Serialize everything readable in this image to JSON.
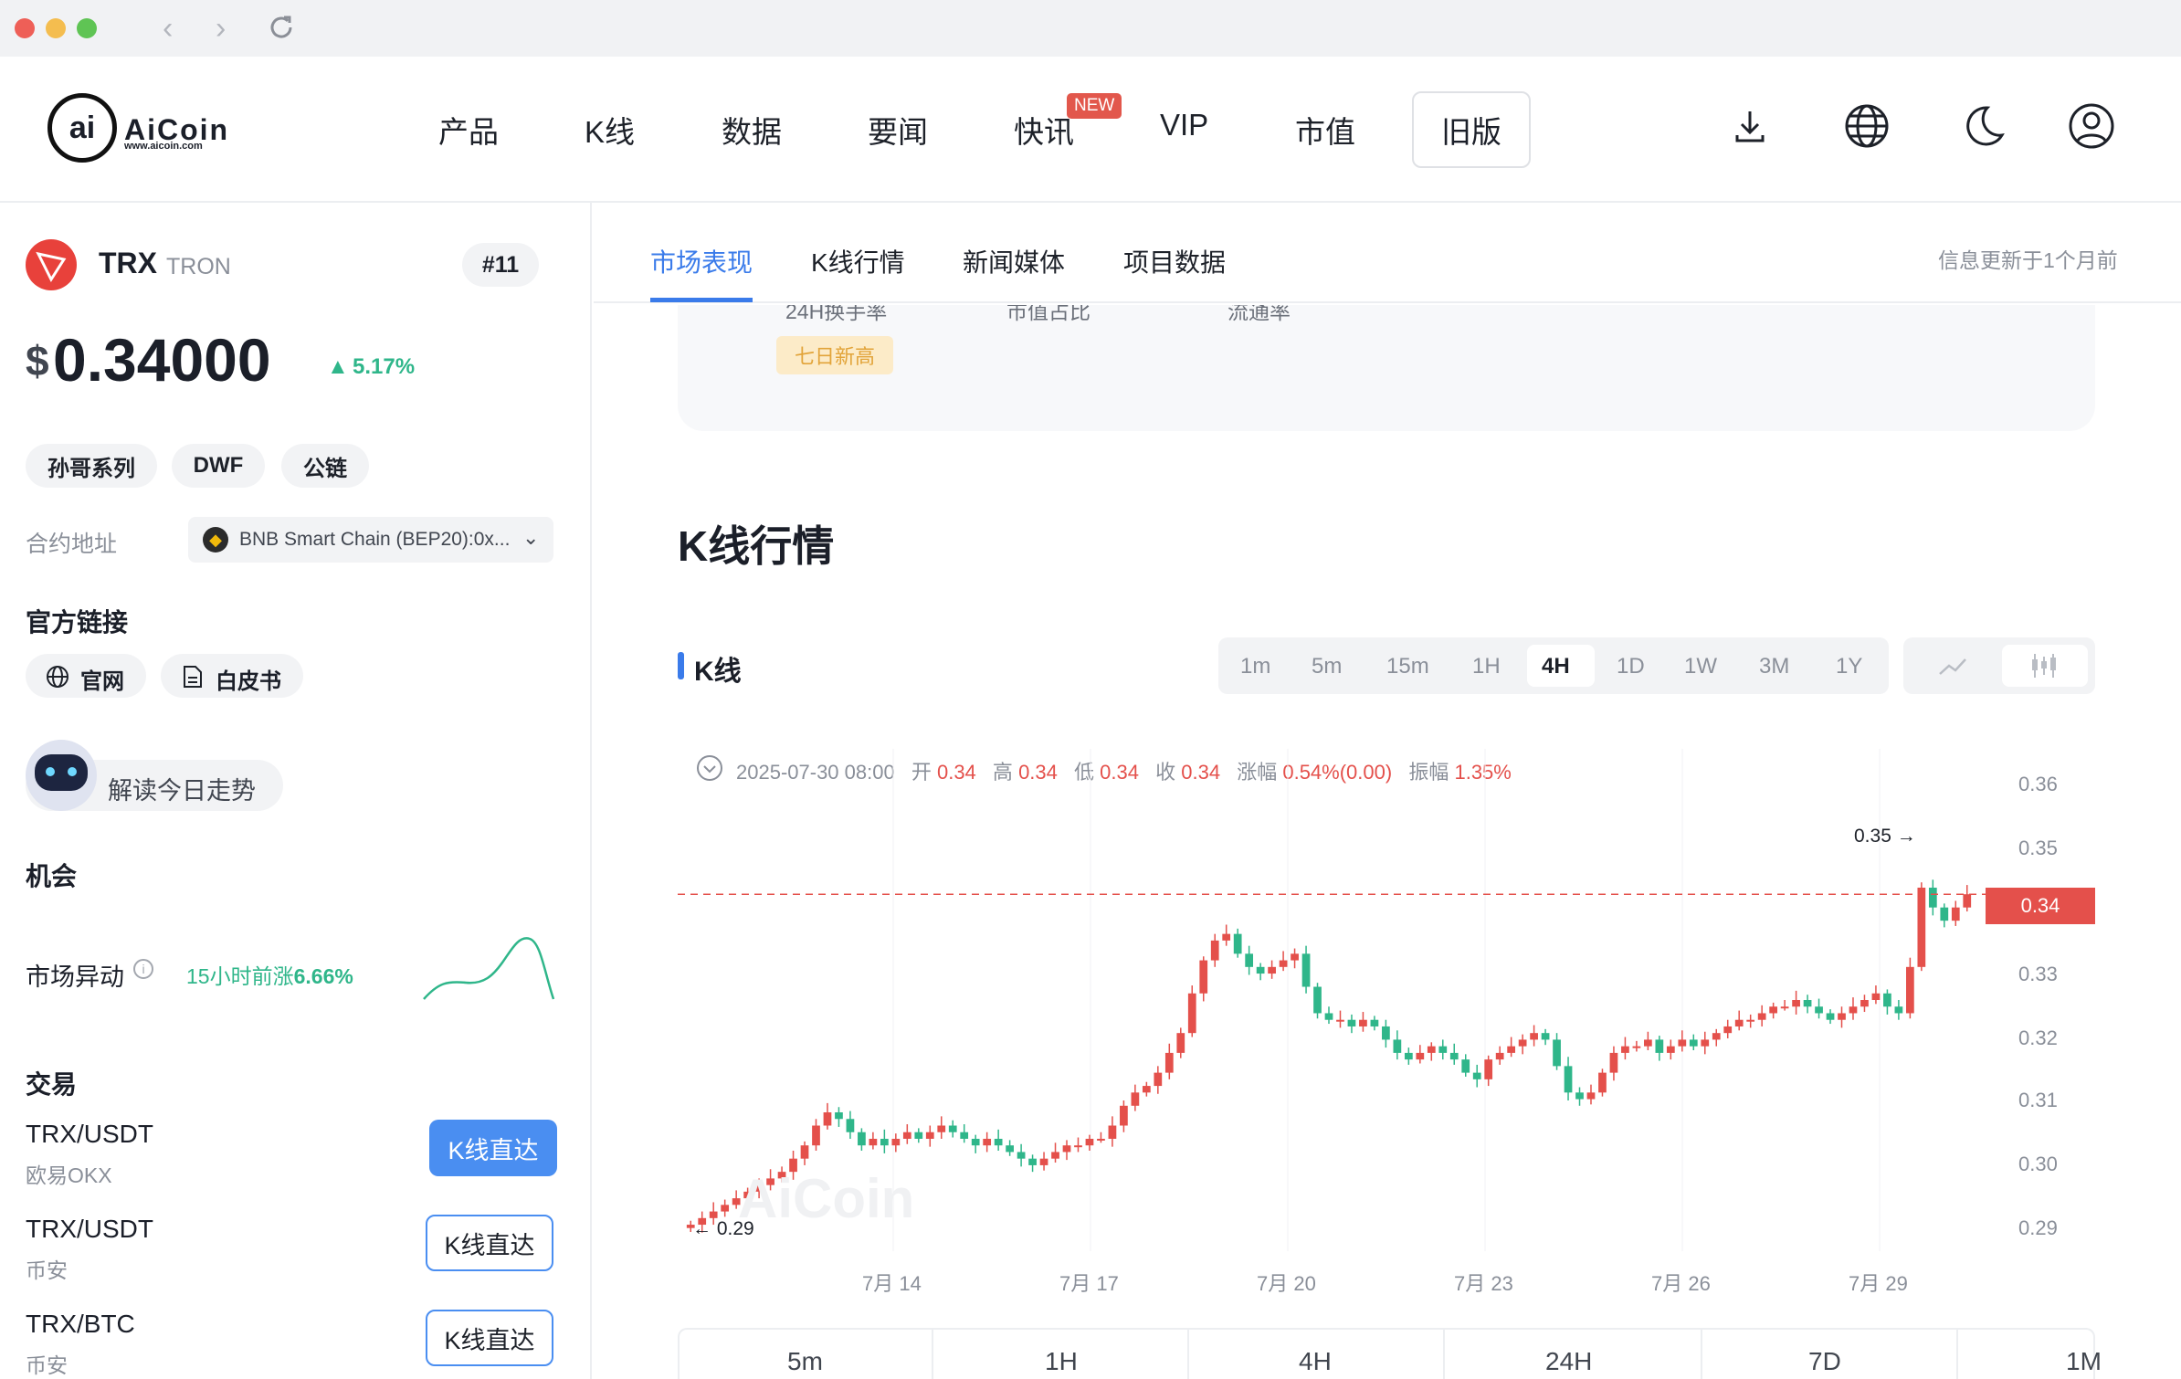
{
  "header": {
    "logo_text": "AiCoin",
    "logo_sub": "www.aicoin.com",
    "nav": [
      "产品",
      "K线",
      "数据",
      "要闻",
      "快讯",
      "VIP",
      "市值",
      "旧版"
    ],
    "new_badge": "NEW"
  },
  "coin": {
    "symbol": "TRX",
    "name": "TRON",
    "rank": "#11",
    "currency": "$",
    "price": "0.34000",
    "change": "5.17%",
    "tags": [
      "孙哥系列",
      "DWF",
      "公链"
    ],
    "contract_label": "合约地址",
    "contract_value": "BNB Smart Chain (BEP20):0x..."
  },
  "links": {
    "title": "官方链接",
    "site": "官网",
    "whitepaper": "白皮书"
  },
  "assistant": {
    "text": "解读今日走势"
  },
  "opportunity": {
    "title": "机会",
    "label": "市场异动",
    "info_prefix": "15小时前涨",
    "info_value": "6.66%"
  },
  "trade": {
    "title": "交易",
    "rows": [
      {
        "pair": "TRX/USDT",
        "exchange": "欧易OKX",
        "button": "K线直达"
      },
      {
        "pair": "TRX/USDT",
        "exchange": "币安",
        "button": "K线直达"
      },
      {
        "pair": "TRX/BTC",
        "exchange": "币安",
        "button": "K线直达"
      }
    ]
  },
  "tabs": {
    "items": [
      "市场表现",
      "K线行情",
      "新闻媒体",
      "项目数据"
    ],
    "updated": "信息更新于1个月前"
  },
  "market_card": {
    "labels": [
      "24H换手率",
      "市值占比",
      "流通率"
    ],
    "badge": "七日新高"
  },
  "kline": {
    "section_title": "K线行情",
    "sub_title": "K线",
    "timeframes": [
      "1m",
      "5m",
      "15m",
      "1H",
      "4H",
      "1D",
      "1W",
      "3M",
      "1Y"
    ],
    "active_tf": "4H",
    "info": {
      "date": "2025-07-30 08:00",
      "open_label": "开",
      "open": "0.34",
      "high_label": "高",
      "high": "0.34",
      "low_label": "低",
      "low": "0.34",
      "close_label": "收",
      "close": "0.34",
      "chg_label": "涨幅",
      "chg": "0.54%(0.00)",
      "amp_label": "振幅",
      "amp": "1.35%"
    },
    "watermark": "AiCoin",
    "max_label": "0.35 →",
    "min_label": "← 0.29",
    "current_price": "0.34",
    "y_ticks": [
      "0.36",
      "0.35",
      "0.34",
      "0.33",
      "0.32",
      "0.31",
      "0.30",
      "0.29"
    ],
    "x_ticks": [
      "7月 14",
      "7月 17",
      "7月 20",
      "7月 23",
      "7月 26",
      "7月 29"
    ]
  },
  "chart_data": {
    "type": "candlestick",
    "ylim": [
      0.286,
      0.362
    ],
    "x_ticks": [
      "7月 14",
      "7月 17",
      "7月 20",
      "7月 23",
      "7月 26",
      "7月 29"
    ],
    "closes": [
      0.29,
      0.291,
      0.292,
      0.293,
      0.294,
      0.295,
      0.296,
      0.297,
      0.298,
      0.3,
      0.302,
      0.305,
      0.307,
      0.306,
      0.304,
      0.302,
      0.303,
      0.302,
      0.303,
      0.304,
      0.303,
      0.304,
      0.305,
      0.304,
      0.303,
      0.302,
      0.303,
      0.302,
      0.301,
      0.3,
      0.299,
      0.3,
      0.301,
      0.302,
      0.302,
      0.303,
      0.303,
      0.305,
      0.308,
      0.31,
      0.311,
      0.313,
      0.316,
      0.319,
      0.325,
      0.33,
      0.333,
      0.334,
      0.331,
      0.329,
      0.328,
      0.329,
      0.33,
      0.331,
      0.326,
      0.322,
      0.321,
      0.321,
      0.32,
      0.321,
      0.32,
      0.318,
      0.316,
      0.315,
      0.316,
      0.317,
      0.316,
      0.315,
      0.313,
      0.312,
      0.315,
      0.316,
      0.317,
      0.318,
      0.319,
      0.318,
      0.314,
      0.31,
      0.309,
      0.31,
      0.313,
      0.316,
      0.317,
      0.317,
      0.318,
      0.316,
      0.317,
      0.318,
      0.317,
      0.318,
      0.319,
      0.32,
      0.321,
      0.321,
      0.322,
      0.323,
      0.323,
      0.324,
      0.323,
      0.322,
      0.321,
      0.322,
      0.323,
      0.324,
      0.325,
      0.323,
      0.322,
      0.329,
      0.341,
      0.338,
      0.336,
      0.338,
      0.34
    ]
  }
}
